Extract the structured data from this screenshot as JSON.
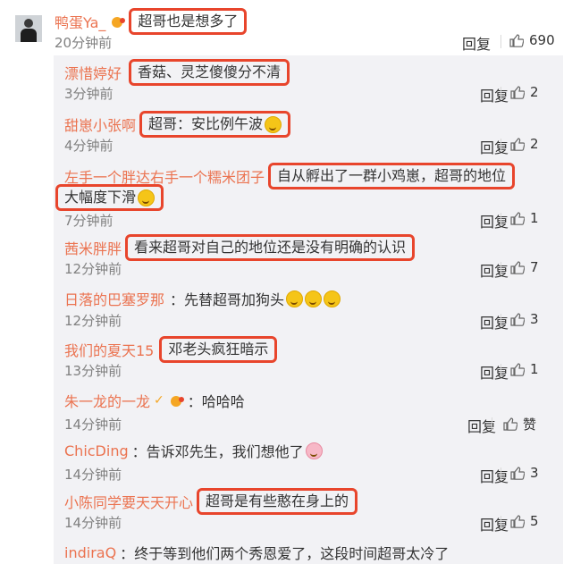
{
  "top_comment": {
    "user": "鸭蛋Ya_",
    "text": "超哥也是想多了",
    "time": "20分钟前",
    "reply_label": "回复",
    "likes": "690"
  },
  "replies": [
    {
      "user": "漂惜婷好",
      "text": "香菇、灵芝傻傻分不清",
      "time": "3分钟前",
      "likes": "2"
    },
    {
      "user": "甜崽小张啊",
      "text": "超哥：安比例午波",
      "time": "4分钟前",
      "likes": "2"
    },
    {
      "user": "左手一个胖达右手一个糯米团子",
      "text": "自从孵出了一群小鸡崽，超哥的地位",
      "text2": "大幅度下滑",
      "time": "7分钟前",
      "likes": "1"
    },
    {
      "user": "茜米胖胖",
      "text": "看来超哥对自己的地位还是没有明确的认识",
      "time": "12分钟前",
      "likes": "7"
    },
    {
      "user": "日落的巴塞罗那",
      "text": "先替超哥加狗头",
      "time": "12分钟前",
      "likes": "3"
    },
    {
      "user": "我们的夏天15",
      "text": "邓老头疯狂暗示",
      "time": "13分钟前",
      "likes": "1"
    },
    {
      "user": "朱一龙的一龙",
      "text": "哈哈哈",
      "time": "14分钟前",
      "likes": "赞"
    },
    {
      "user": "ChicDing",
      "text": "告诉邓先生，我们想他了",
      "time": "14分钟前",
      "likes": "3"
    },
    {
      "user": "小陈同学要天天开心",
      "text": "超哥是有些憨在身上的",
      "time": "14分钟前",
      "likes": "5"
    },
    {
      "user": "indiraQ",
      "text": "终于等到他们两个秀恩爱了，这段时间超哥太冷了"
    }
  ],
  "reply_label": "回复",
  "colors": {
    "name": "#eb7350",
    "highlight_box": "#e8452c",
    "sub_panel_bg": "#f2f2f5"
  }
}
